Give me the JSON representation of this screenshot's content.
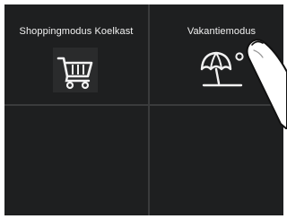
{
  "tiles": {
    "shopping": {
      "label": "Shoppingmodus Koelkast",
      "icon": "shopping-cart-icon"
    },
    "vacation": {
      "label": "Vakantiemodus",
      "icon": "beach-umbrella-sun-icon"
    }
  },
  "colors": {
    "background": "#1e1f20",
    "divider": "#3a3b3c",
    "text": "#f2f2f2"
  }
}
